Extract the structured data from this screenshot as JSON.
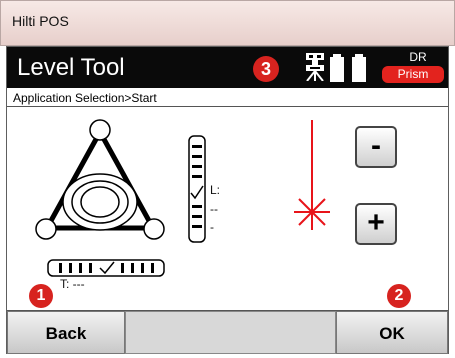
{
  "window": {
    "title": "Hilti POS"
  },
  "header": {
    "title": "Level Tool",
    "callout_number": "3",
    "icons": [
      "instrument-icon",
      "battery-icon"
    ],
    "dr_label": "DR",
    "prism_label": "Prism"
  },
  "breadcrumb": "Application Selection>Start",
  "level": {
    "vertical_label_l": "L:",
    "vertical_value_1": "--",
    "vertical_value_2": "-",
    "horizontal_label_t": "T: ---"
  },
  "controls": {
    "minus_label": "-",
    "plus_label": "+"
  },
  "footer": {
    "back_label": "Back",
    "ok_label": "OK",
    "back_callout": "1",
    "ok_callout": "2"
  },
  "colors": {
    "accent_red": "#e3231e",
    "laser_red": "#e8141a"
  }
}
